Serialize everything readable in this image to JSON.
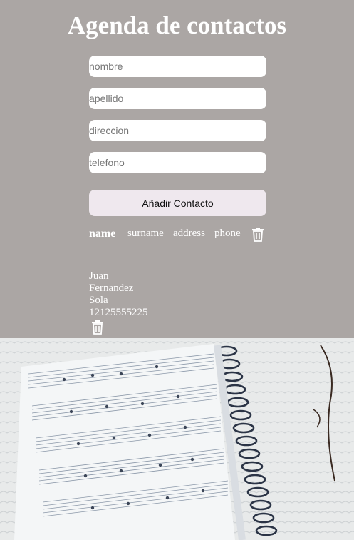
{
  "app": {
    "title": "Agenda de contactos"
  },
  "form": {
    "nombre_placeholder": "nombre",
    "apellido_placeholder": "apellido",
    "direccion_placeholder": "direccion",
    "telefono_placeholder": "telefono",
    "submit_label": "Añadir Contacto"
  },
  "table_header": {
    "name": "name",
    "surname": "surname",
    "address": "address",
    "phone": "phone",
    "delete_icon": "trash-icon"
  },
  "contacts": [
    {
      "name": "Juan",
      "surname": "Fernandez",
      "address": "Sola",
      "phone": "12125555225",
      "delete_icon": "trash-icon"
    }
  ],
  "background": {
    "image_icon": "sheet-music-notebook",
    "accent": "#aba6a4",
    "button_bg": "#efe8ee"
  }
}
